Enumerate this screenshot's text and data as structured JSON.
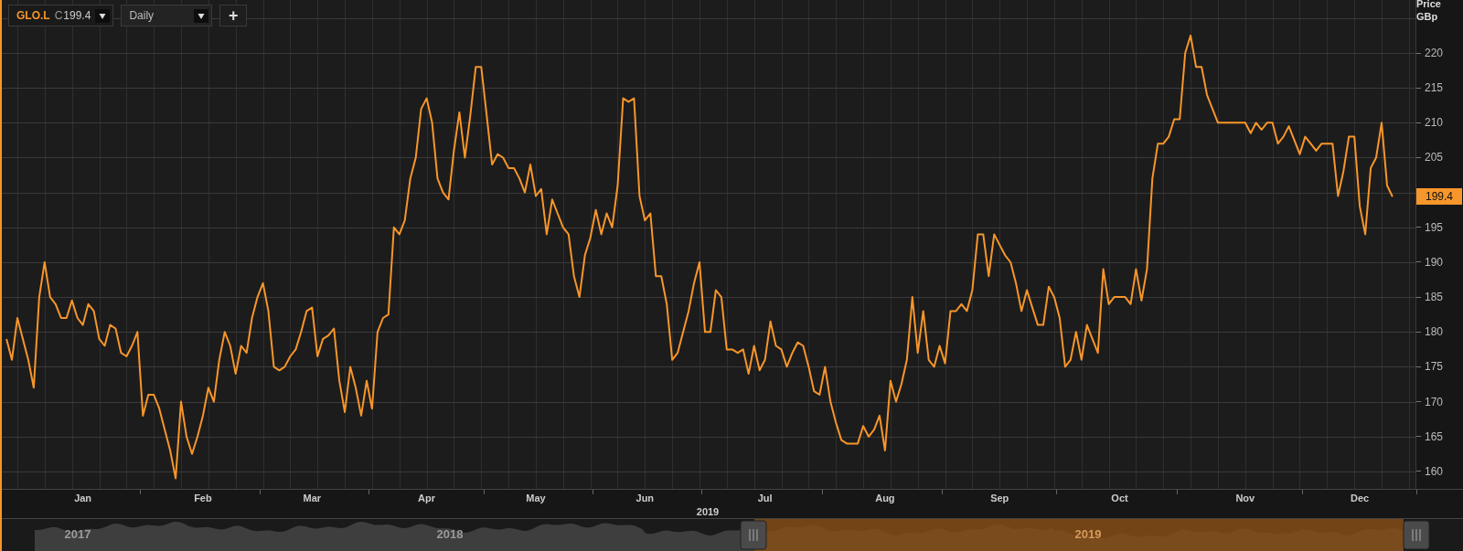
{
  "toolbar": {
    "price_prefix": "C",
    "price": "199.4",
    "interval": "Daily",
    "add_button": "+"
  },
  "chart": {
    "axis_title": "Price",
    "axis_unit": "GBp",
    "last_price_label": "199.4",
    "year_label": "2019",
    "chart_data": {
      "type": "line",
      "grid": true,
      "ylim": [
        157.5,
        227.6
      ],
      "yticks": [
        160,
        165,
        170,
        175,
        180,
        185,
        190,
        195,
        205,
        210,
        215,
        220
      ],
      "categories": [
        null,
        null,
        null,
        null,
        null,
        null,
        null,
        null,
        null,
        null,
        null,
        null,
        null,
        null,
        "Jan",
        null,
        null,
        null,
        null,
        null,
        null,
        null,
        null,
        null,
        null,
        null,
        null,
        null,
        null,
        null,
        null,
        null,
        null,
        null,
        null,
        null,
        "Feb",
        null,
        null,
        null,
        null,
        null,
        null,
        null,
        null,
        null,
        null,
        null,
        null,
        null,
        null,
        null,
        null,
        null,
        null,
        null,
        "Mar",
        null,
        null,
        null,
        null,
        null,
        null,
        null,
        null,
        null,
        null,
        null,
        null,
        null,
        null,
        null,
        null,
        null,
        null,
        null,
        null,
        "Apr",
        null,
        null,
        null,
        null,
        null,
        null,
        null,
        null,
        null,
        null,
        null,
        null,
        null,
        null,
        null,
        null,
        null,
        null,
        null,
        "May",
        null,
        null,
        null,
        null,
        null,
        null,
        null,
        null,
        null,
        null,
        null,
        null,
        null,
        null,
        null,
        null,
        null,
        null,
        null,
        "Jun",
        null,
        null,
        null,
        null,
        null,
        null,
        null,
        null,
        null,
        null,
        null,
        null,
        null,
        null,
        null,
        null,
        null,
        null,
        null,
        null,
        null,
        "Jul",
        null,
        null,
        null,
        null,
        null,
        null,
        null,
        null,
        null,
        null,
        null,
        null,
        null,
        null,
        null,
        null,
        null,
        null,
        null,
        null,
        null,
        "Aug",
        null,
        null,
        null,
        null,
        null,
        null,
        null,
        null,
        null,
        null,
        null,
        null,
        null,
        null,
        null,
        null,
        null,
        null,
        null,
        null,
        "Sep",
        null,
        null,
        null,
        null,
        null,
        null,
        null,
        null,
        null,
        null,
        null,
        null,
        null,
        null,
        null,
        null,
        null,
        null,
        null,
        null,
        null,
        "Oct",
        null,
        null,
        null,
        null,
        null,
        null,
        null,
        null,
        null,
        null,
        null,
        null,
        null,
        null,
        null,
        null,
        null,
        null,
        null,
        null,
        null,
        null,
        "Nov",
        null,
        null,
        null,
        null,
        null,
        null,
        null,
        null,
        null,
        null,
        null,
        null,
        null,
        null,
        null,
        null,
        null,
        null,
        null,
        null,
        "Dec",
        null,
        null,
        null,
        null,
        null,
        null
      ],
      "series": [
        {
          "name": "GLO.L",
          "color": "#f7962a",
          "values": [
            179,
            176,
            182,
            179,
            176,
            172,
            185,
            190,
            185,
            184,
            182,
            182,
            184.5,
            182,
            181,
            184,
            183,
            179,
            178,
            181,
            180.5,
            177,
            176.5,
            178,
            180,
            168,
            171,
            171,
            169,
            166,
            163,
            159,
            170,
            165,
            162.5,
            165,
            168,
            172,
            170,
            176,
            180,
            178,
            174,
            178,
            177,
            182,
            185,
            187,
            183,
            175,
            174.5,
            175,
            176.5,
            177.5,
            180,
            183,
            183.5,
            176.5,
            179,
            179.5,
            180.5,
            173,
            168.5,
            175,
            172,
            168,
            173,
            169,
            180,
            182,
            182.5,
            195,
            194,
            196,
            202,
            205,
            212,
            213.5,
            210,
            202,
            200,
            199,
            206,
            211.5,
            205,
            211,
            218,
            218,
            211,
            204,
            205.5,
            205,
            203.5,
            203.5,
            202,
            200,
            204,
            199.5,
            200.5,
            194,
            199,
            197,
            195,
            194,
            188,
            185,
            191,
            193.5,
            197.5,
            194,
            197,
            195,
            201,
            213.5,
            213,
            213.5,
            199.5,
            196,
            197,
            188,
            188,
            184,
            176,
            177,
            180,
            183,
            187,
            190,
            180,
            180,
            186,
            185,
            177.5,
            177.5,
            177,
            177.5,
            174,
            178,
            174.5,
            176,
            181.5,
            178,
            177.5,
            175,
            177,
            178.5,
            178,
            175,
            171.5,
            171,
            175,
            170,
            167,
            164.5,
            164,
            164,
            164,
            166.5,
            165,
            166,
            168,
            163,
            173,
            170,
            172.5,
            176,
            185,
            177,
            183,
            176,
            175,
            178,
            175.5,
            183,
            183,
            184,
            183,
            186,
            194,
            194,
            188,
            194,
            192.5,
            191,
            190,
            187,
            183,
            186,
            183.5,
            181,
            181,
            186.5,
            185,
            182,
            175,
            176,
            180,
            176,
            181,
            179,
            177,
            189,
            184,
            185,
            185,
            185,
            184,
            189,
            184.5,
            189,
            202,
            207,
            207,
            208,
            210.5,
            210.5,
            220,
            222.5,
            218,
            218,
            214,
            212,
            210,
            210,
            210,
            210,
            210,
            210,
            208.5,
            210,
            209,
            210,
            210,
            207,
            208,
            209.5,
            207.5,
            205.5,
            208,
            207,
            206,
            207,
            207,
            207,
            199.5,
            203,
            208,
            208,
            198,
            194,
            203.5,
            205,
            210,
            201,
            199.4
          ]
        }
      ]
    }
  },
  "navigator": {
    "labels": [
      "2017",
      "2018",
      "2019"
    ]
  }
}
